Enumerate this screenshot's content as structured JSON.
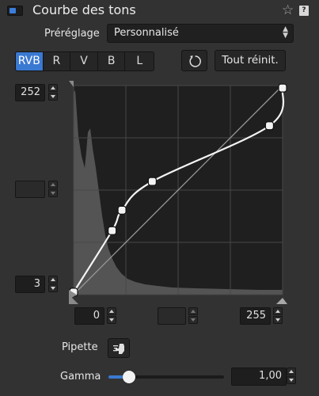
{
  "header": {
    "title": "Courbe des tons",
    "star_icon": "star-icon",
    "help_label": "?"
  },
  "preset": {
    "label": "Préréglage",
    "value": "Personnalisé"
  },
  "channels": [
    {
      "label": "RVB",
      "active": true
    },
    {
      "label": "R",
      "active": false
    },
    {
      "label": "V",
      "active": false
    },
    {
      "label": "B",
      "active": false
    },
    {
      "label": "L",
      "active": false
    }
  ],
  "buttons": {
    "reset_icon": "rotate-ccw-icon",
    "reset_all": "Tout réinit."
  },
  "levels": {
    "output_high": "252",
    "output_mid": "",
    "output_low": "3"
  },
  "input": {
    "low": "0",
    "mid": "",
    "high": "255"
  },
  "curve": {
    "control_points": [
      [
        0,
        3
      ],
      [
        47,
        78
      ],
      [
        59,
        103
      ],
      [
        96,
        138
      ],
      [
        239,
        206
      ],
      [
        255,
        252
      ]
    ]
  },
  "pipette": {
    "label": "Pipette"
  },
  "gamma": {
    "label": "Gamma",
    "value": "1,00",
    "slider_fraction": 0.18
  },
  "colors": {
    "accent": "#3a79d2",
    "panel": "#323232",
    "graph_bg": "#1f1f1f"
  }
}
